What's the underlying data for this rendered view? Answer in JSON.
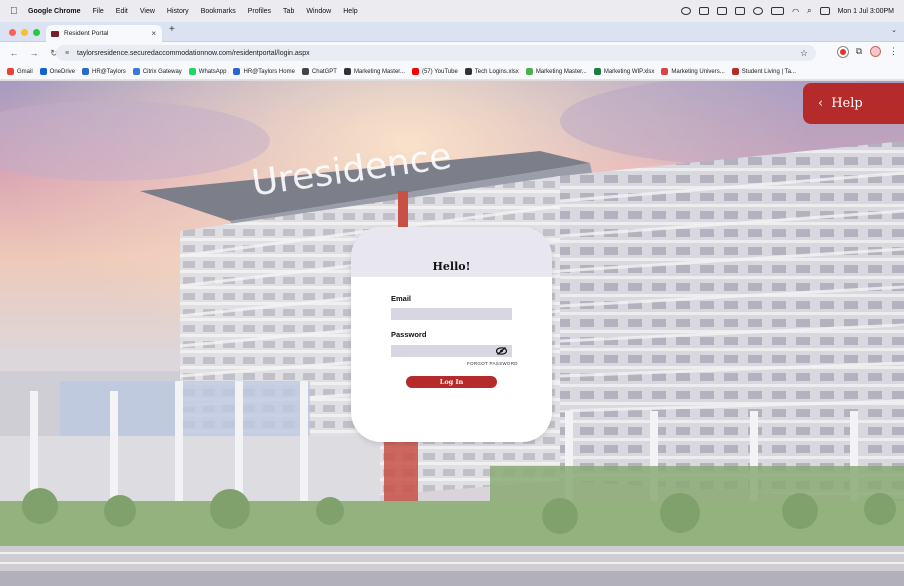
{
  "menubar": {
    "app": "Google Chrome",
    "items": [
      "File",
      "Edit",
      "View",
      "History",
      "Bookmarks",
      "Profiles",
      "Tab",
      "Window",
      "Help"
    ],
    "clock": "Mon 1 Jul  3:00PM"
  },
  "tab": {
    "title": "Resident Portal",
    "close": "×"
  },
  "newtab": "+",
  "tabmenu": "⌄",
  "toolbar": {
    "back": "←",
    "forward": "→",
    "reload": "↻",
    "url": "taylorsresidence.securedaccommodationnow.com/residentportal/login.aspx",
    "star": "☆",
    "extensions": "⧉",
    "menu": "⋮"
  },
  "bookmarks": [
    {
      "label": "Gmail",
      "color": "#ea4335"
    },
    {
      "label": "OneDrive",
      "color": "#0a64d8"
    },
    {
      "label": "HR@Taylors",
      "color": "#2a6acc"
    },
    {
      "label": "Citrix Gateway",
      "color": "#3a7bd5"
    },
    {
      "label": "WhatsApp",
      "color": "#25d366"
    },
    {
      "label": "HR@Taylors Home",
      "color": "#2a6acc"
    },
    {
      "label": "ChatGPT",
      "color": "#444444"
    },
    {
      "label": "Marketing Master...",
      "color": "#333333"
    },
    {
      "label": "(57) YouTube",
      "color": "#ff0000"
    },
    {
      "label": "Tech Logins.xlsx",
      "color": "#333333"
    },
    {
      "label": "Marketing Master...",
      "color": "#4caf50"
    },
    {
      "label": "Marketing WIP.xlsx",
      "color": "#1e7b3f"
    },
    {
      "label": "Marketing Univers...",
      "color": "#d44"
    },
    {
      "label": "Student Living | Ta...",
      "color": "#b52a2a"
    }
  ],
  "hero": {
    "sign": "Uresidence"
  },
  "help": {
    "chevron": "‹",
    "label": "Help"
  },
  "login": {
    "heading": "Hello!",
    "email_label": "Email",
    "email_value": "",
    "password_label": "Password",
    "password_value": "",
    "forgot": "FORGOT PASSWORD",
    "button": "Log In"
  },
  "colors": {
    "accent": "#b52a2a",
    "card_head": "#e8e6ee",
    "input": "#d8d6e0"
  }
}
